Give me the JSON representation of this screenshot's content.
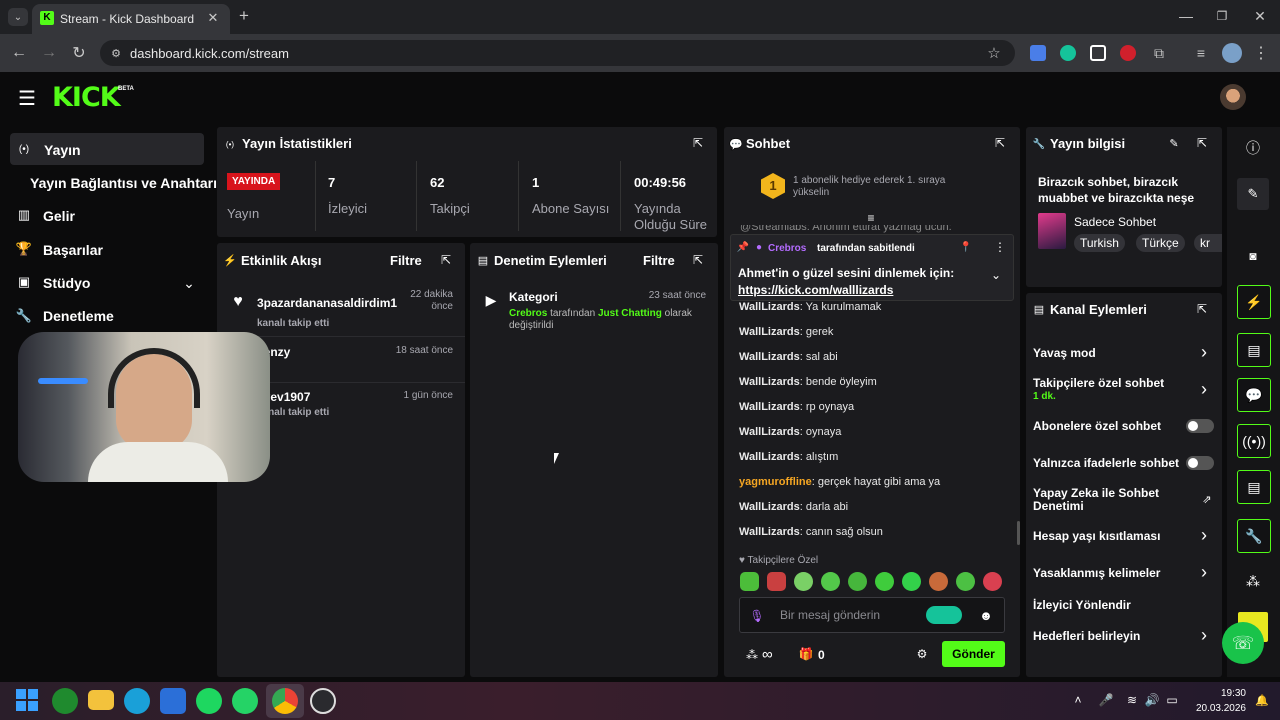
{
  "browser": {
    "tab_title": "Stream - Kick Dashboard",
    "url": "dashboard.kick.com/stream"
  },
  "brand": {
    "logo": "KICK",
    "beta": "BETA",
    "accent": "#53fc18"
  },
  "sidebar": {
    "items": [
      {
        "label": "Yayın"
      },
      {
        "label": "Yayın Bağlantısı ve Anahtarı"
      },
      {
        "label": "Gelir"
      },
      {
        "label": "Başarılar"
      },
      {
        "label": "Stüdyo"
      },
      {
        "label": "Denetleme"
      }
    ]
  },
  "stats": {
    "title": "Yayın İstatistikleri",
    "live_badge": "YAYINDA",
    "live_label": "Yayın",
    "viewers": "7",
    "viewers_label": "İzleyici",
    "followers": "62",
    "followers_label": "Takipçi",
    "subs": "1",
    "subs_label": "Abone Sayısı",
    "duration": "00:49:56",
    "duration_label": "Yayında Olduğu Süre"
  },
  "activity": {
    "title": "Etkinlik Akışı",
    "filter": "Filtre",
    "items": [
      {
        "name": "3pazardananasaldirdim1",
        "time": "22 dakika önce",
        "desc": "kanalı takip etti"
      },
      {
        "name": "lienzy",
        "time": "18 saat önce",
        "desc": ""
      },
      {
        "name": "liyev1907",
        "time": "1 gün önce",
        "desc": "kanalı takip etti"
      }
    ]
  },
  "moderation": {
    "title": "Denetim Eylemleri",
    "filter": "Filtre",
    "item_title": "Kategori",
    "time": "23 saat önce",
    "actor": "Crebros",
    "mid": "tarafından",
    "target": "Just Chatting",
    "rest": "olarak",
    "tail": "değiştirildi"
  },
  "chat": {
    "title": "Sohbet",
    "gift_text": "1 abonelik hediye ederek 1. sıraya yükselin",
    "gift_rank": "1",
    "cutoff": "@Streamlabs: Anonim ettirat yazmag ucun:",
    "pinned_by": "Crebros",
    "pinned_suffix": "tarafından sabitlendi",
    "pinned_text": "Ahmet'in o güzel sesini dinlemek için:",
    "pinned_link": "https://kick.com/walllizards",
    "messages": [
      {
        "user": "WallLizards",
        "text": "Ya kurulmamak",
        "color": "#eaeaea"
      },
      {
        "user": "WallLizards",
        "text": "gerek",
        "color": "#eaeaea"
      },
      {
        "user": "WallLizards",
        "text": "sal abi",
        "color": "#eaeaea"
      },
      {
        "user": "WallLizards",
        "text": "bende öyleyim",
        "color": "#eaeaea"
      },
      {
        "user": "WallLizards",
        "text": "rp oynaya",
        "color": "#eaeaea"
      },
      {
        "user": "WallLizards",
        "text": "oynaya",
        "color": "#eaeaea"
      },
      {
        "user": "WallLizards",
        "text": "alıştım",
        "color": "#eaeaea"
      },
      {
        "user": "yagmuroffline",
        "text": "gerçek hayat gibi ama ya",
        "color": "#f5a623"
      },
      {
        "user": "WallLizards",
        "text": "darla abi",
        "color": "#eaeaea"
      },
      {
        "user": "WallLizards",
        "text": "canın sağ olsun",
        "color": "#eaeaea"
      }
    ],
    "followers_only": "Takipçilere Özel",
    "placeholder": "Bir mesaj gönderin",
    "points": "0",
    "send": "Gönder",
    "infinity": "∞"
  },
  "info": {
    "title": "Yayın bilgisi",
    "stream_title": "Birazcık sohbet, birazcık muabbet ve birazcıkta neşe",
    "category": "Sadece Sohbet",
    "tags": [
      "Turkish",
      "Türkçe",
      "kr"
    ]
  },
  "channel_actions": {
    "title": "Kanal Eylemleri",
    "items": [
      {
        "label": "Yavaş mod",
        "sub": "",
        "type": "chevron"
      },
      {
        "label": "Takipçilere özel sohbet",
        "sub": "1 dk.",
        "type": "chevron"
      },
      {
        "label": "Abonelere özel sohbet",
        "sub": "",
        "type": "toggle"
      },
      {
        "label": "Yalnızca ifadelerle sohbet",
        "sub": "",
        "type": "toggle"
      },
      {
        "label": "Yapay Zeka ile Sohbet Denetimi",
        "sub": "",
        "type": "external"
      },
      {
        "label": "Hesap yaşı kısıtlaması",
        "sub": "",
        "type": "chevron"
      },
      {
        "label": "Yasaklanmış kelimeler",
        "sub": "",
        "type": "chevron"
      },
      {
        "label": "İzleyici Yönlendir",
        "sub": "",
        "type": "none"
      },
      {
        "label": "Hedefleri belirleyin",
        "sub": "",
        "type": "chevron"
      }
    ]
  },
  "taskbar": {
    "time": "19:30",
    "date": "20.03.2026"
  }
}
